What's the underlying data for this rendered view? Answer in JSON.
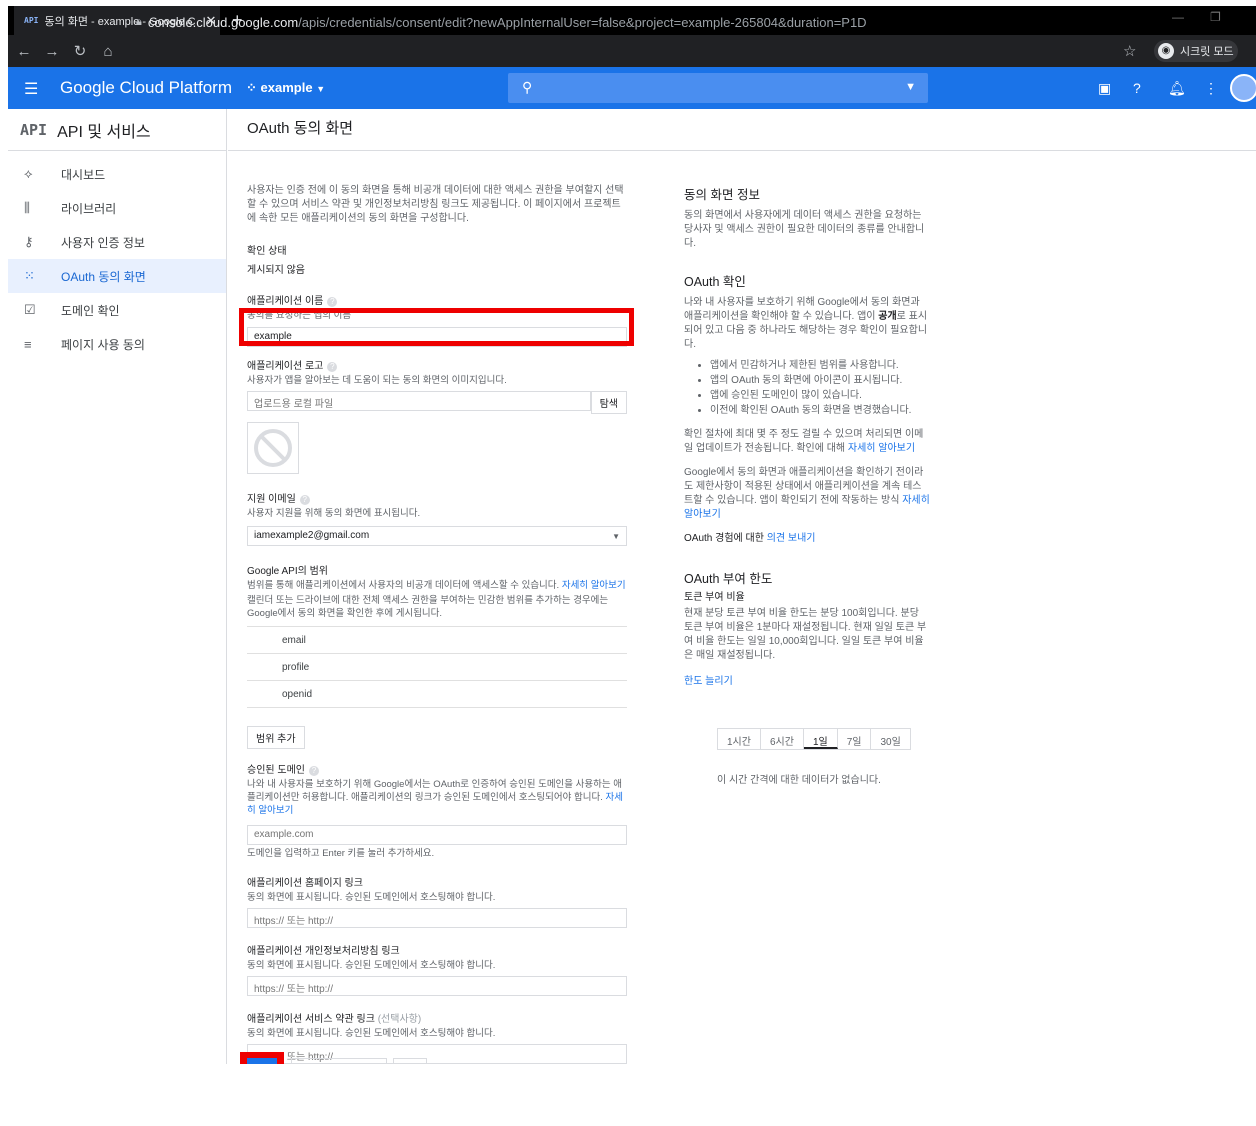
{
  "browser": {
    "tab_title": "동의 화면 - example - Google C",
    "url_host": "console.cloud.google.com",
    "url_path": "/apis/credentials/consent/edit?newAppInternalUser=false&project=example-265804&duration=P1D",
    "incognito_label": "시크릿 모드"
  },
  "header": {
    "brand": "Google Cloud Platform",
    "project": "example"
  },
  "sidebar": {
    "badge": "API",
    "title": "API 및 서비스",
    "items": [
      {
        "label": "대시보드",
        "icon": "dashboard-icon"
      },
      {
        "label": "라이브러리",
        "icon": "library-icon"
      },
      {
        "label": "사용자 인증 정보",
        "icon": "key-icon"
      },
      {
        "label": "OAuth 동의 화면",
        "icon": "consent-icon"
      },
      {
        "label": "도메인 확인",
        "icon": "domain-check-icon"
      },
      {
        "label": "페이지 사용 동의",
        "icon": "page-consent-icon"
      }
    ]
  },
  "page": {
    "title": "OAuth 동의 화면"
  },
  "form": {
    "intro": "사용자는 인증 전에 이 동의 화면을 통해 비공개 데이터에 대한 액세스 권한을 부여할지 선택할 수 있으며 서비스 약관 및 개인정보처리방침 링크도 제공됩니다. 이 페이지에서 프로젝트에 속한 모든 애플리케이션의 동의 화면을 구성합니다.",
    "verify_status_label": "확인 상태",
    "verify_status_value": "게시되지 않음",
    "app_name_label": "애플리케이션 이름",
    "app_name_sub": "동의를 요청하는 앱의 이름",
    "app_name_value": "example",
    "app_logo_label": "애플리케이션 로고",
    "app_logo_sub": "사용자가 앱을 알아보는 데 도움이 되는 동의 화면의 이미지입니다.",
    "file_placeholder": "업로드용 로컬 파일",
    "browse_label": "탐색",
    "support_email_label": "지원 이메일",
    "support_email_sub": "사용자 지원을 위해 동의 화면에 표시됩니다.",
    "support_email_value": "iamexample2@gmail.com",
    "scopes_label": "Google API의 범위",
    "scopes_sub": "범위를 통해 애플리케이션에서 사용자의 비공개 데이터에 액세스할 수 있습니다.",
    "scopes_link": "자세히 알아보기",
    "scopes_sub2": "캘린더 또는 드라이브에 대한 전체 액세스 권한을 부여하는 민감한 범위를 추가하는 경우에는 Google에서 동의 화면을 확인한 후에 게시됩니다.",
    "scopes": [
      "email",
      "profile",
      "openid"
    ],
    "add_scope_label": "범위 추가",
    "authorized_domain_label": "승인된 도메인",
    "authorized_domain_sub": "나와 내 사용자를 보호하기 위해 Google에서는 OAuth로 인증하여 승인된 도메인을 사용하는 애플리케이션만 허용합니다. 애플리케이션의 링크가 승인된 도메인에서 호스팅되어야 합니다.",
    "authorized_domain_link": "자세히 알아보기",
    "domain_placeholder": "example.com",
    "domain_hint": "도메인을 입력하고 Enter 키를 눌러 추가하세요.",
    "homepage_label": "애플리케이션 홈페이지 링크",
    "homepage_sub": "동의 화면에 표시됩니다. 승인된 도메인에서 호스팅해야 합니다.",
    "privacy_label": "애플리케이션 개인정보처리방침 링크",
    "privacy_sub": "동의 화면에 표시됩니다. 승인된 도메인에서 호스팅해야 합니다.",
    "terms_label": "애플리케이션 서비스 약관 링크",
    "terms_optional": "(선택사항)",
    "terms_sub": "동의 화면에 표시됩니다. 승인된 도메인에서 호스팅해야 합니다.",
    "url_placeholder": "https:// 또는 http://"
  },
  "info": {
    "consent_title": "동의 화면 정보",
    "consent_text": "동의 화면에서 사용자에게 데이터 액세스 권한을 요청하는 당사자 및 액세스 권한이 필요한 데이터의 종류를 안내합니다.",
    "oauth_verify_title": "OAuth 확인",
    "oauth_verify_text_a": "나와 내 사용자를 보호하기 위해 Google에서 동의 화면과 애플리케이션을 확인해야 할 수 있습니다. 앱이",
    "oauth_verify_text_b": "공개",
    "oauth_verify_text_c": "로 표시되어 있고 다음 중 하나라도 해당하는 경우 확인이 필요합니다.",
    "bullets": [
      "앱에서 민감하거나 제한된 범위를 사용합니다.",
      "앱의 OAuth 동의 화면에 아이콘이 표시됩니다.",
      "앱에 승인된 도메인이 많이 있습니다.",
      "이전에 확인된 OAuth 동의 화면을 변경했습니다."
    ],
    "process_text": "확인 절차에 최대 몇 주 정도 걸릴 수 있으며 처리되면 이메일 업데이트가 전송됩니다. 확인에 대해",
    "process_link": "자세히 알아보기",
    "testing_text": "Google에서 동의 화면과 애플리케이션을 확인하기 전이라도 제한사항이 적용된 상태에서 애플리케이션을 계속 테스트할 수 있습니다. 앱이 확인되기 전에 작동하는 방식",
    "testing_link": "자세히 알아보기",
    "feedback_text": "OAuth 경험에 대한",
    "feedback_link": "의견 보내기",
    "limit_title": "OAuth 부여 한도",
    "limit_sub": "토큰 부여 비율",
    "limit_text": "현재 분당 토큰 부여 비율 한도는 분당 100회입니다. 분당 토큰 부여 비율은 1분마다 재설정됩니다. 현재 일일 토큰 부여 비율 한도는 일일 10,000회입니다. 일일 토큰 부여 비율은 매일 재설정됩니다.",
    "increase_link": "한도 늘리기",
    "ranges": [
      "1시간",
      "6시간",
      "1일",
      "7일",
      "30일"
    ],
    "selected_range": "1일",
    "no_data": "이 시간 간격에 대한 데이터가 없습니다."
  },
  "colors": {
    "primary": "#1a73e8",
    "highlight": "#ee0000"
  }
}
